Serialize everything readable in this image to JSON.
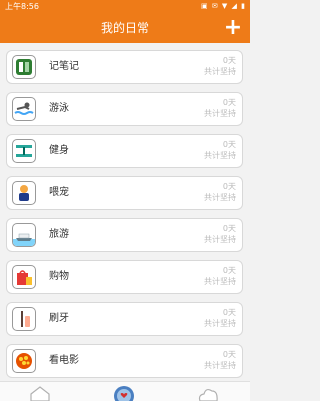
{
  "status": {
    "time": "上午8:56",
    "icons": "▣ ✉ ▼ ◢ ▮"
  },
  "header": {
    "title": "我的日常",
    "add_label": "+"
  },
  "items": [
    {
      "name": "记笔记",
      "days": "0天",
      "sub": "共计坚持",
      "icon": "notebook-icon"
    },
    {
      "name": "游泳",
      "days": "0天",
      "sub": "共计坚持",
      "icon": "swim-icon"
    },
    {
      "name": "健身",
      "days": "0天",
      "sub": "共计坚持",
      "icon": "dumbbell-icon"
    },
    {
      "name": "喂宠",
      "days": "0天",
      "sub": "共计坚持",
      "icon": "pet-icon"
    },
    {
      "name": "旅游",
      "days": "0天",
      "sub": "共计坚持",
      "icon": "cruise-ship-icon"
    },
    {
      "name": "购物",
      "days": "0天",
      "sub": "共计坚持",
      "icon": "shopping-icon"
    },
    {
      "name": "刷牙",
      "days": "0天",
      "sub": "共计坚持",
      "icon": "toothbrush-icon"
    },
    {
      "name": "看电影",
      "days": "0天",
      "sub": "共计坚持",
      "icon": "popcorn-icon"
    }
  ],
  "tabs": [
    "home-tab-icon",
    "heart-tab-icon",
    "cloud-tab-icon"
  ]
}
